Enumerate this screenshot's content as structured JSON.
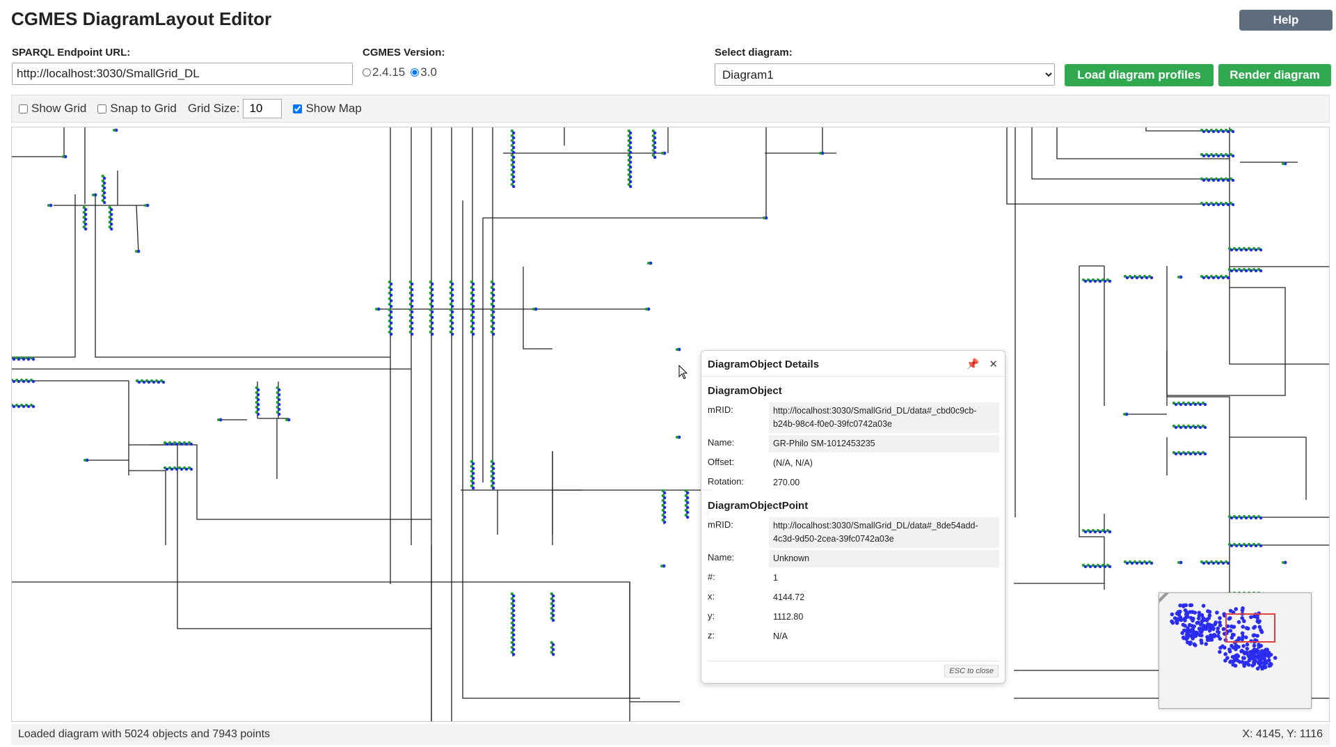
{
  "app": {
    "title": "CGMES DiagramLayout Editor",
    "help_label": "Help"
  },
  "form": {
    "endpoint_label": "SPARQL Endpoint URL:",
    "endpoint_value": "http://localhost:3030/SmallGrid_DL",
    "version_label": "CGMES Version:",
    "versions": [
      {
        "label": "2.4.15",
        "checked": false
      },
      {
        "label": "3.0",
        "checked": true
      }
    ],
    "diagram_label": "Select diagram:",
    "diagram_selected": "Diagram1",
    "load_button": "Load diagram profiles",
    "render_button": "Render diagram"
  },
  "toolbar": {
    "show_grid_label": "Show Grid",
    "show_grid_checked": false,
    "snap_grid_label": "Snap to Grid",
    "snap_grid_checked": false,
    "grid_size_label": "Grid Size:",
    "grid_size_value": "10",
    "show_map_label": "Show Map",
    "show_map_checked": true
  },
  "popup": {
    "title": "DiagramObject Details",
    "diagram_object": {
      "section_title": "DiagramObject",
      "mrid_label": "mRID:",
      "mrid_value": "http://localhost:3030/SmallGrid_DL/data#_cbd0c9cb-b24b-98c4-f0e0-39fc0742a03e",
      "name_label": "Name:",
      "name_value": "GR-Philo SM-1012453235",
      "offset_label": "Offset:",
      "offset_value": "(N/A, N/A)",
      "rotation_label": "Rotation:",
      "rotation_value": "270.00"
    },
    "diagram_object_point": {
      "section_title": "DiagramObjectPoint",
      "mrid_label": "mRID:",
      "mrid_value": "http://localhost:3030/SmallGrid_DL/data#_8de54add-4c3d-9d50-2cea-39fc0742a03e",
      "name_label": "Name:",
      "name_value": "Unknown",
      "seq_label": "#:",
      "seq_value": "1",
      "x_label": "x:",
      "x_value": "4144.72",
      "y_label": "y:",
      "y_value": "1112.80",
      "z_label": "z:",
      "z_value": "N/A"
    },
    "esc_hint": "ESC to close"
  },
  "status": {
    "message": "Loaded diagram with 5024 objects and 7943 points",
    "coords": "X: 4145, Y: 1116"
  },
  "colors": {
    "line": "#222222",
    "node_green": "#1e9e2a",
    "node_blue": "#1f2ee0",
    "button_green": "#2fa84f",
    "help_grey": "#5d6d7e"
  }
}
